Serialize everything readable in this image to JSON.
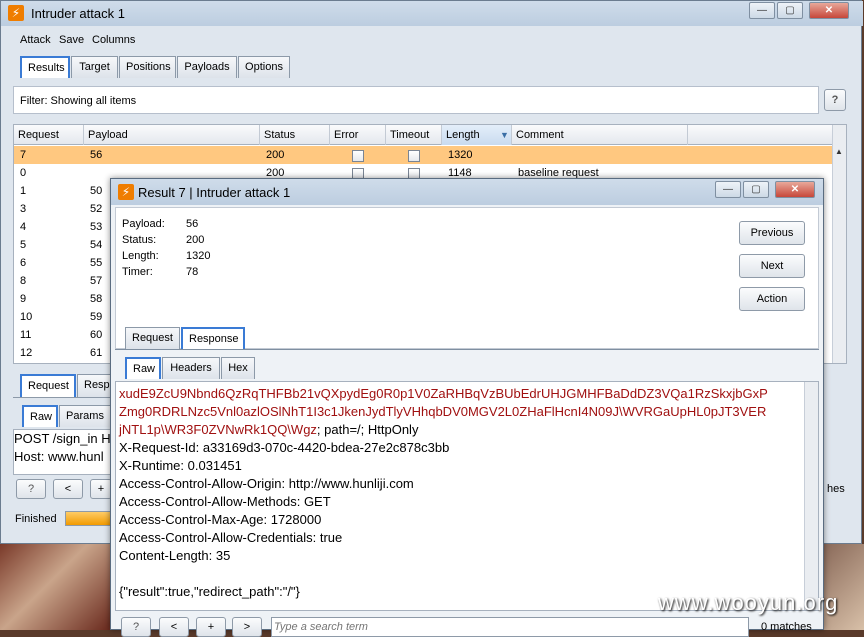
{
  "main": {
    "title": "Intruder attack 1",
    "menu": [
      "Attack",
      "Save",
      "Columns"
    ],
    "tabs": [
      "Results",
      "Target",
      "Positions",
      "Payloads",
      "Options"
    ],
    "filter_text": "Filter:  Showing all items",
    "help_label": "?",
    "table": {
      "headers": [
        "Request",
        "Payload",
        "Status",
        "Error",
        "Timeout",
        "Length",
        "Comment"
      ],
      "rows": [
        {
          "request": "7",
          "payload": "56",
          "status": "200",
          "length": "1320",
          "comment": "",
          "selected": true
        },
        {
          "request": "0",
          "payload": "",
          "status": "200",
          "length": "1148",
          "comment": "baseline request"
        },
        {
          "request": "1",
          "payload": "50",
          "status": "",
          "length": "",
          "comment": ""
        },
        {
          "request": "3",
          "payload": "52",
          "status": "",
          "length": "",
          "comment": ""
        },
        {
          "request": "4",
          "payload": "53",
          "status": "",
          "length": "",
          "comment": ""
        },
        {
          "request": "5",
          "payload": "54",
          "status": "",
          "length": "",
          "comment": ""
        },
        {
          "request": "6",
          "payload": "55",
          "status": "",
          "length": "",
          "comment": ""
        },
        {
          "request": "8",
          "payload": "57",
          "status": "",
          "length": "",
          "comment": ""
        },
        {
          "request": "9",
          "payload": "58",
          "status": "",
          "length": "",
          "comment": ""
        },
        {
          "request": "10",
          "payload": "59",
          "status": "",
          "length": "",
          "comment": ""
        },
        {
          "request": "11",
          "payload": "60",
          "status": "",
          "length": "",
          "comment": ""
        },
        {
          "request": "12",
          "payload": "61",
          "status": "",
          "length": "",
          "comment": ""
        }
      ]
    },
    "lower_tabs": [
      "Request",
      "Resp"
    ],
    "lower_subtabs": [
      "Raw",
      "Params"
    ],
    "lower_text": [
      "POST /sign_in H",
      "Host: www.hunl"
    ],
    "nav_buttons": [
      "?",
      "<",
      "+"
    ],
    "matches_label": "hes",
    "status_label": "Finished",
    "progress": 1.0
  },
  "popup": {
    "title": "Result 7 | Intruder attack 1",
    "info": [
      {
        "label": "Payload:",
        "value": "56"
      },
      {
        "label": "Status:",
        "value": "200"
      },
      {
        "label": "Length:",
        "value": "1320"
      },
      {
        "label": "Timer:",
        "value": "78"
      }
    ],
    "buttons": [
      "Previous",
      "Next",
      "Action"
    ],
    "tabs": [
      "Request",
      "Response"
    ],
    "subtabs": [
      "Raw",
      "Headers",
      "Hex"
    ],
    "response_lines_red": [
      "xudE9ZcU9Nbnd6QzRqTHFBb21vQXpydEg0R0p1V0ZaRHBqVzBUbEdrUHJGMHFBaDdDZ3VQa1RzSkxjbGxP",
      "Zmg0RDRLNzc5Vnl0azlOSlNhT1I3c1JkenJydTlyVHhqbDV0MGV2L0ZHaFlHcnI4N09J\\WVRGaUpHL0pJT3VER",
      "jNTL1p\\WR3F0ZVNwRk1QQ\\Wgz"
    ],
    "cookie_tail": "; path=/; HttpOnly",
    "response_lines": [
      "X-Request-Id: a33169d3-070c-4420-bdea-27e2c878c3bb",
      "X-Runtime: 0.031451",
      "Access-Control-Allow-Origin: http://www.hunliji.com",
      "Access-Control-Allow-Methods: GET",
      "Access-Control-Max-Age: 1728000",
      "Access-Control-Allow-Credentials: true",
      "Content-Length: 35",
      "",
      "{\"result\":true,\"redirect_path\":\"/\"}"
    ],
    "search_buttons": [
      "?",
      "<",
      "+",
      ">"
    ],
    "search_placeholder": "Type a search term",
    "matches": "0 matches"
  },
  "watermark": "www.wooyun.org"
}
